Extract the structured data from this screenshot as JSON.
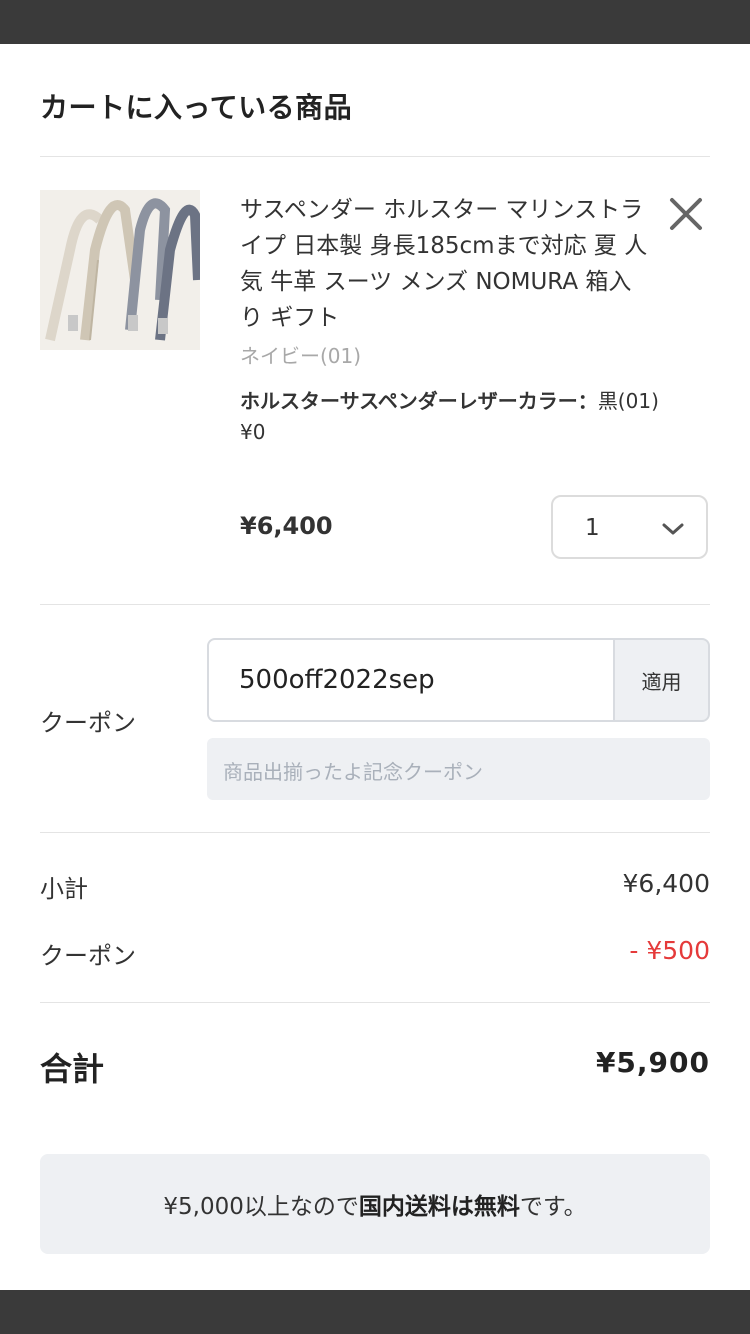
{
  "cart": {
    "title": "カートに入っている商品"
  },
  "item": {
    "name": "サスペンダー ホルスター マリンストライプ 日本製 身長185cmまで対応 夏 人気 牛革 スーツ メンズ NOMURA 箱入り ギフト",
    "variant": "ネイビー(01)",
    "option_label": "ホルスターサスペンダーレザーカラー：",
    "option_value": "黒(01) ¥0",
    "price": "¥6,400",
    "quantity": "1",
    "remove_icon": "close-icon",
    "image_alt_icon": "suspenders-product-image"
  },
  "coupon": {
    "label": "クーポン",
    "code": "500off2022sep",
    "apply_label": "適用",
    "applied_name": "商品出揃ったよ記念クーポン"
  },
  "summary": {
    "subtotal_label": "小計",
    "subtotal_value": "¥6,400",
    "coupon_label": "クーポン",
    "coupon_value": "- ¥500",
    "total_label": "合計",
    "total_value": "¥5,900"
  },
  "shipping": {
    "prefix": "¥5,000以上なので",
    "emphasis": "国内送料は無料",
    "suffix": "です。"
  },
  "colors": {
    "accent_discount": "#e53a3a",
    "bar": "#3a3a3a",
    "muted_bg": "#eef0f3"
  }
}
